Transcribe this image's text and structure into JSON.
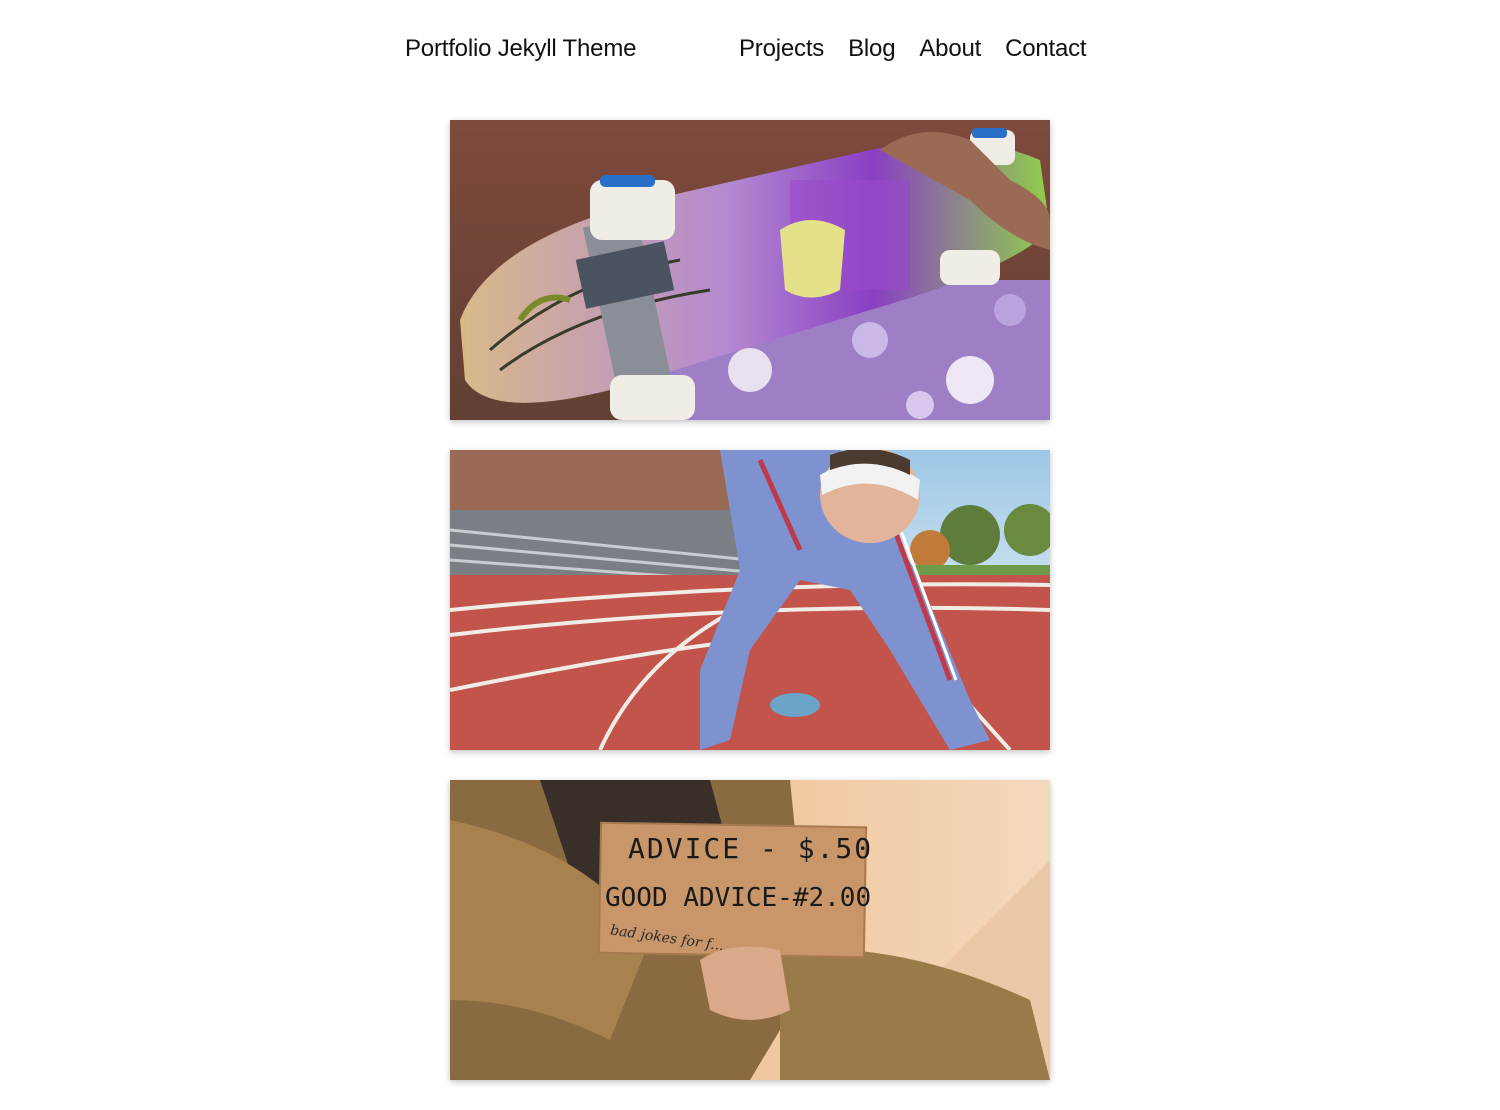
{
  "header": {
    "site_title": "Portfolio Jekyll Theme",
    "nav": [
      "Projects",
      "Blog",
      "About",
      "Contact"
    ]
  },
  "projects": [
    {
      "thumbnail": "skateboard-photo"
    },
    {
      "thumbnail": "runner-on-track-photo"
    },
    {
      "thumbnail": "cardboard-sign-photo",
      "sign_line_1": "ADVICE - $.50",
      "sign_line_2": "GOOD ADVICE-#2.00",
      "sign_line_3": "bad jokes for f..."
    }
  ]
}
